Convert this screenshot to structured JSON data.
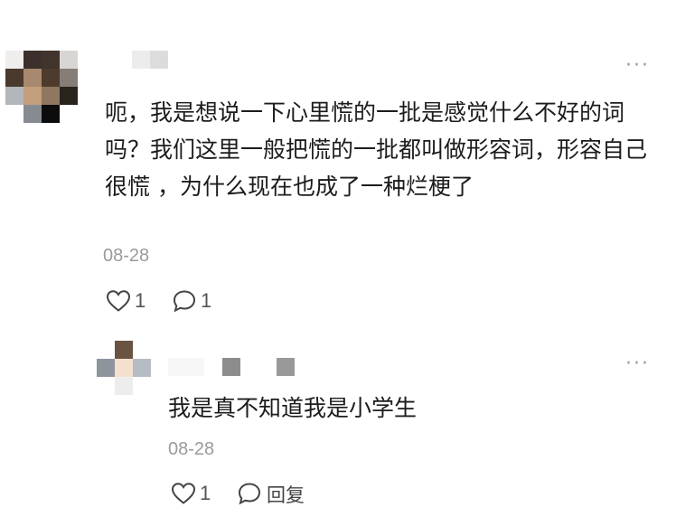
{
  "comment": {
    "text": "呃，我是想说一下心里慌的一批是感觉什么不好的词吗？我们这里一般把慌的一批都叫做形容词，形容自己很慌 ，为什么现在也成了一种烂梗了",
    "date": "08-28",
    "like_count": "1",
    "comment_count": "1",
    "more_label": "···"
  },
  "reply": {
    "text": "我是真不知道我是小学生",
    "date": "08-28",
    "like_count": "1",
    "reply_label": "回复",
    "more_label": "···"
  }
}
